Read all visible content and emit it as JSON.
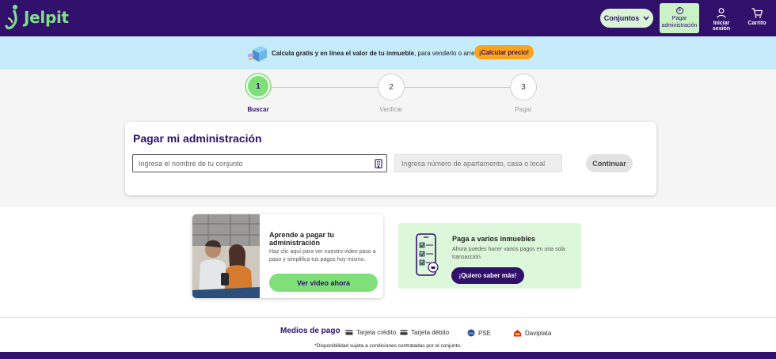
{
  "brand": {
    "name": "Jelpit"
  },
  "header": {
    "select_label": "Conjuntos",
    "pay_label_1": "Pagar",
    "pay_label_2": "administración",
    "login_label": "Iniciar sesión",
    "cart_label": "Carrito"
  },
  "promo": {
    "text_bold": "Calcula gratis y en línea el valor de tu inmueble",
    "text_rest": ", para venderlo o arrendarlo.",
    "button": "¡Calcular precio!"
  },
  "stepper": {
    "steps": [
      {
        "number": "1",
        "label": "Buscar"
      },
      {
        "number": "2",
        "label": "Verificar"
      },
      {
        "number": "3",
        "label": "Pagar"
      }
    ]
  },
  "form": {
    "title": "Pagar mi administración",
    "conjunto_placeholder": "Ingresa el nombre de tu conjunto",
    "apto_placeholder": "Ingresa número de apartamento, casa o local",
    "continue": "Continuar"
  },
  "video_card": {
    "title": "Aprende a pagar tu administración",
    "description": "Haz clic aquí para ver nuestro video paso a paso y simplifica tus pagos hoy mismo.",
    "button": "Ver video ahora"
  },
  "multi_card": {
    "title": "Paga a varios inmuebles",
    "description": "Ahora puedes hacer varios pagos en una sola transacción.",
    "button": "¡Quiero saber más!"
  },
  "payments": {
    "title": "Medios de pago",
    "methods": [
      "Tarjeta crédito",
      "Tarjeta débito",
      "PSE",
      "Daviplata"
    ],
    "footnote": "*Disponibilidad sujeta a condiciones contratadas por el conjunto."
  },
  "colors": {
    "brand_purple": "#30106b",
    "brand_green": "#7fe07a",
    "promo_bg": "#c6ebfa",
    "promo_button": "#ffa21c"
  }
}
